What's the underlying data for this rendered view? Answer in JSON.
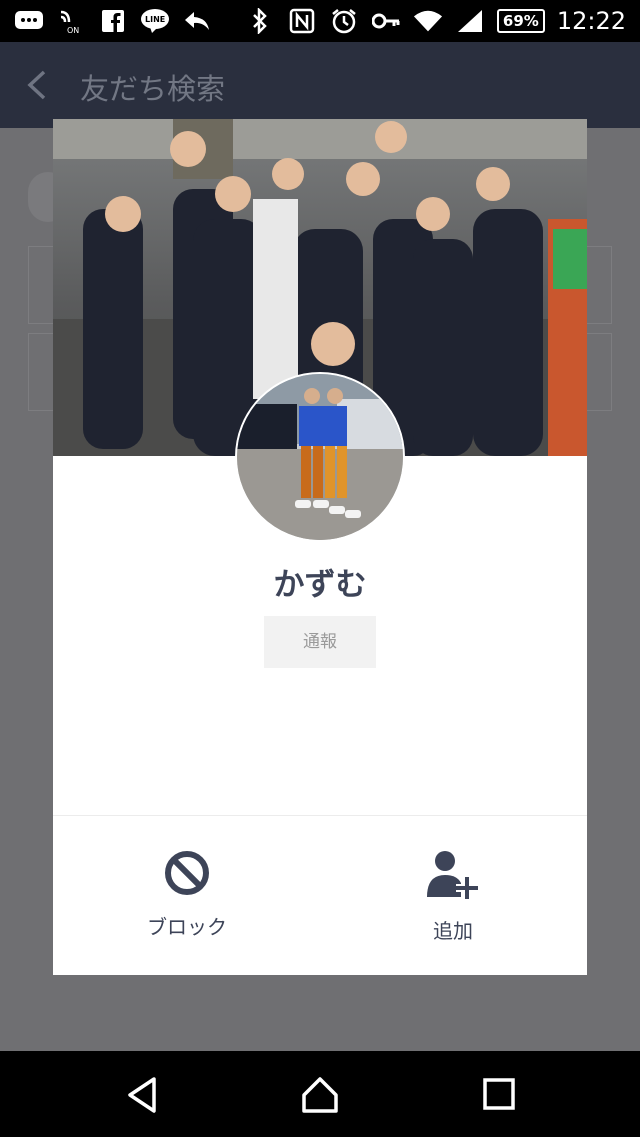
{
  "status_bar": {
    "battery_percent": "69%",
    "time": "12:22",
    "left_icons": [
      "messages-icon",
      "nfc-on-icon",
      "facebook-icon",
      "line-icon",
      "reply-icon"
    ],
    "right_icons": [
      "bluetooth-icon",
      "nfc-icon",
      "alarm-icon",
      "key-icon",
      "wifi-icon",
      "signal-icon"
    ]
  },
  "header": {
    "title": "友だち検索"
  },
  "profile_modal": {
    "name": "かずむ",
    "report_label": "通報",
    "actions": [
      {
        "label": "ブロック",
        "icon": "block-icon"
      },
      {
        "label": "追加",
        "icon": "add-friend-icon"
      }
    ]
  },
  "nav_bar": {
    "buttons": [
      "back-icon",
      "home-icon",
      "recents-icon"
    ]
  },
  "colors": {
    "accent": "#3d4458",
    "header_bg": "#2a2f3e",
    "overlay": "#6f6f72"
  }
}
